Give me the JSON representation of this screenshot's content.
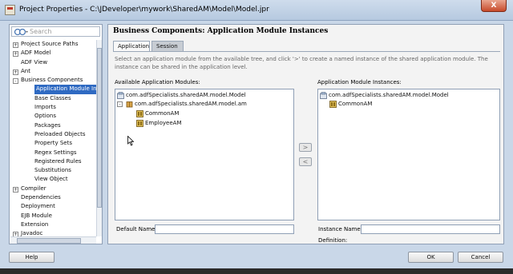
{
  "window": {
    "title": "Project Properties - C:\\JDeveloper\\mywork\\SharedAM\\Model\\Model.jpr",
    "close_label": "X"
  },
  "search": {
    "placeholder": "Search"
  },
  "nav_tree": [
    {
      "label": "Project Source Paths",
      "expander": "+",
      "depth": 0
    },
    {
      "label": "ADF Model",
      "expander": "+",
      "depth": 0
    },
    {
      "label": "ADF View",
      "expander": "",
      "depth": 0
    },
    {
      "label": "Ant",
      "expander": "+",
      "depth": 0
    },
    {
      "label": "Business Components",
      "expander": "-",
      "depth": 0
    },
    {
      "label": "Application Module Inst",
      "expander": "",
      "depth": 1,
      "selected": true
    },
    {
      "label": "Base Classes",
      "expander": "",
      "depth": 1
    },
    {
      "label": "Imports",
      "expander": "",
      "depth": 1
    },
    {
      "label": "Options",
      "expander": "",
      "depth": 1
    },
    {
      "label": "Packages",
      "expander": "",
      "depth": 1
    },
    {
      "label": "Preloaded Objects",
      "expander": "",
      "depth": 1
    },
    {
      "label": "Property Sets",
      "expander": "",
      "depth": 1
    },
    {
      "label": "Regex Settings",
      "expander": "",
      "depth": 1
    },
    {
      "label": "Registered Rules",
      "expander": "",
      "depth": 1
    },
    {
      "label": "Substitutions",
      "expander": "",
      "depth": 1
    },
    {
      "label": "View Object",
      "expander": "",
      "depth": 1
    },
    {
      "label": "Compiler",
      "expander": "+",
      "depth": 0
    },
    {
      "label": "Dependencies",
      "expander": "",
      "depth": 0
    },
    {
      "label": "Deployment",
      "expander": "",
      "depth": 0
    },
    {
      "label": "EJB Module",
      "expander": "",
      "depth": 0
    },
    {
      "label": "Extension",
      "expander": "",
      "depth": 0
    },
    {
      "label": "Javadoc",
      "expander": "+",
      "depth": 0
    }
  ],
  "main": {
    "header": "Business Components: Application Module Instances",
    "tabs": [
      "Application",
      "Session"
    ],
    "description": "Select an application module from the available tree, and click '>' to create a named instance of the shared application module. The instance can be shared in the application level.",
    "available_label": "Available Application Modules:",
    "instances_label": "Application Module Instances:",
    "available_tree": [
      {
        "text": "com.adfSpecialists.sharedAM.model.Model",
        "icon": "project-icon",
        "expander": ""
      },
      {
        "text": "com.adfSpecialists.sharedAM.model.am",
        "icon": "package-icon",
        "expander": "-"
      },
      {
        "text": "CommonAM",
        "icon": "app-module-icon",
        "expander": ""
      },
      {
        "text": "EmployeeAM",
        "icon": "app-module-icon",
        "expander": ""
      }
    ],
    "instances_tree": [
      {
        "text": "com.adfSpecialists.sharedAM.model.Model",
        "icon": "project-icon"
      },
      {
        "text": "CommonAM",
        "icon": "app-module-icon"
      }
    ],
    "move_right": ">",
    "move_left": "<",
    "default_name_label": "Default Name:",
    "default_name_value": "",
    "instance_name_label": "Instance Name:",
    "instance_name_value": "",
    "definition_label": "Definition:"
  },
  "footer": {
    "help": "Help",
    "ok": "OK",
    "cancel": "Cancel"
  }
}
